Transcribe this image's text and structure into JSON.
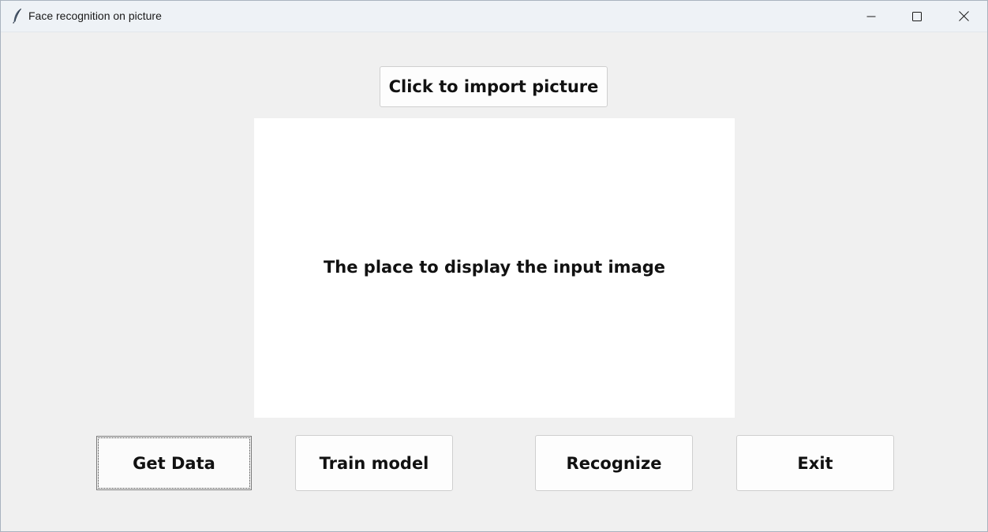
{
  "window": {
    "title": "Face recognition on picture",
    "icon": "feather-icon",
    "controls": {
      "minimize": "minimize-icon",
      "maximize": "maximize-icon",
      "close": "close-icon"
    }
  },
  "main": {
    "import_button_label": "Click to import picture",
    "image_placeholder": "The place to display the input image",
    "buttons": {
      "get_data": "Get Data",
      "train_model": "Train model",
      "recognize": "Recognize",
      "exit": "Exit"
    }
  }
}
